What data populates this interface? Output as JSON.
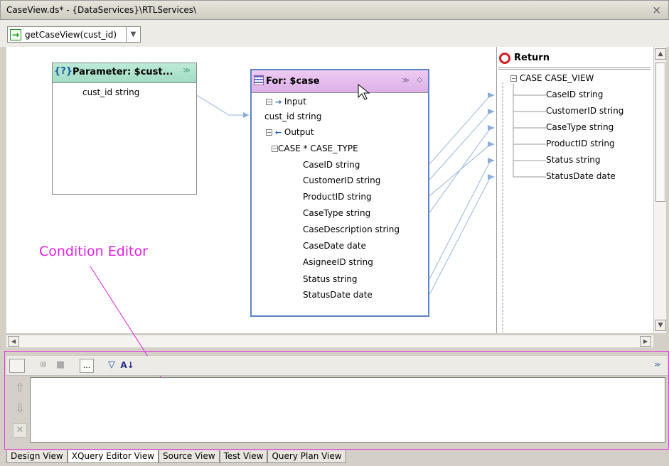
{
  "window": {
    "title": "CaseView.ds* - {DataServices}\\RTLServices\\",
    "close_glyph": "×"
  },
  "function_selector": {
    "value": "getCaseView(cust_id)"
  },
  "parameter_box": {
    "title": "Parameter: $cust...",
    "field": "cust_id string"
  },
  "for_box": {
    "title": "For: $case",
    "input_label": "Input",
    "input_field": "cust_id string",
    "output_label": "Output",
    "element": "CASE * CASE_TYPE",
    "fields": [
      "CaseID string",
      "CustomerID string",
      "ProductID string",
      "CaseType string",
      "CaseDescription string",
      "CaseDate date",
      "AsigneeID string",
      "Status string",
      "StatusDate date"
    ]
  },
  "return_box": {
    "title": "Return",
    "element": "CASE CASE_VIEW",
    "fields": [
      "CaseID string",
      "CustomerID string",
      "CaseType string",
      "ProductID string",
      "Status string",
      "StatusDate date"
    ]
  },
  "annotation": "Condition Editor",
  "tabs": [
    "Design View",
    "XQuery Editor View",
    "Source View",
    "Test View",
    "Query Plan View"
  ],
  "active_tab": "XQuery Editor View",
  "colors": {
    "parameter_header": "#a2dcc4",
    "for_header": "#dcb0e8",
    "for_border": "#5c82c8",
    "link_line": "#a8c0e0",
    "annotation": "#e020e0"
  }
}
